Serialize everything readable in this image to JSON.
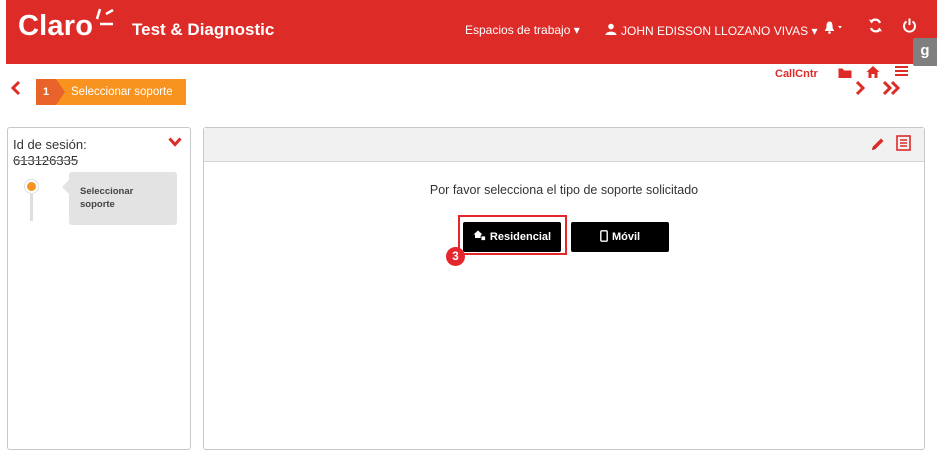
{
  "header": {
    "brand": "Claro",
    "app_title": "Test & Diagnostic",
    "workspaces_label": "Espacios de trabajo ▾",
    "user_name": "JOHN EDISSON LLOZANO VIVAS ▾",
    "side_tab": "g"
  },
  "wizard": {
    "step_number": "1",
    "step_label": "Seleccionar soporte",
    "callcntr_label": "CallCntr"
  },
  "left_panel": {
    "session_label": "Id de sesión:",
    "session_id": "613126335",
    "timeline_step": "Seleccionar soporte"
  },
  "main": {
    "prompt": "Por favor selecciona el tipo de soporte solicitado",
    "buttons": {
      "residencial": "Residencial",
      "movil": "Móvil"
    },
    "callout_number": "3"
  },
  "colors": {
    "brand_red": "#dd2b28",
    "step_orange": "#f7931e",
    "highlight_red": "#e5272d"
  }
}
